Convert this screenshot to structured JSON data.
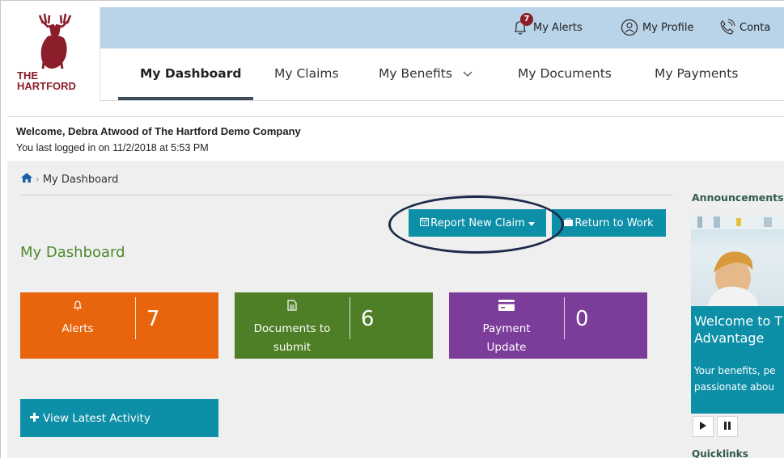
{
  "header": {
    "logo_text_line1": "THE",
    "logo_text_line2": "HARTFORD",
    "alerts_badge": "7",
    "alerts_label": "My Alerts",
    "profile_label": "My Profile",
    "contact_label": "Conta"
  },
  "nav": {
    "items": [
      {
        "label": "My Dashboard",
        "active": true
      },
      {
        "label": "My Claims",
        "active": false
      },
      {
        "label": "My Benefits",
        "active": false
      },
      {
        "label": "My Documents",
        "active": false
      },
      {
        "label": "My Payments",
        "active": false
      }
    ]
  },
  "welcome": {
    "line1": "Welcome, Debra Atwood of The Hartford Demo Company",
    "line2": "You last logged in on 11/2/2018 at 5:53 PM"
  },
  "breadcrumb": {
    "current": "My Dashboard"
  },
  "actions": {
    "report_label": "Report New Claim",
    "return_label": "Return to Work"
  },
  "dashboard": {
    "title": "My Dashboard",
    "tiles": [
      {
        "label_line1": "Alerts",
        "label_line2": "",
        "count": "7",
        "color": "#e8650e",
        "icon": "bell-icon"
      },
      {
        "label_line1": "Documents to",
        "label_line2": "submit",
        "count": "6",
        "color": "#4e7f26",
        "icon": "document-icon"
      },
      {
        "label_line1": "Payment",
        "label_line2": "Update",
        "count": "0",
        "color": "#7c3c9a",
        "icon": "credit-card-icon"
      }
    ],
    "activity_label": "View Latest Activity"
  },
  "announcements": {
    "title": "Announcements",
    "heading_line1": "Welcome to T",
    "heading_line2": "Advantage",
    "body_line1": "Your benefits, pe",
    "body_line2": "passionate abou",
    "bottom_label": "Quicklinks"
  },
  "colors": {
    "topbar": "#b9d3e8",
    "accent": "#0d8fa7",
    "brand": "#8c1d2a",
    "dashboard_title": "#4d8a2a"
  }
}
